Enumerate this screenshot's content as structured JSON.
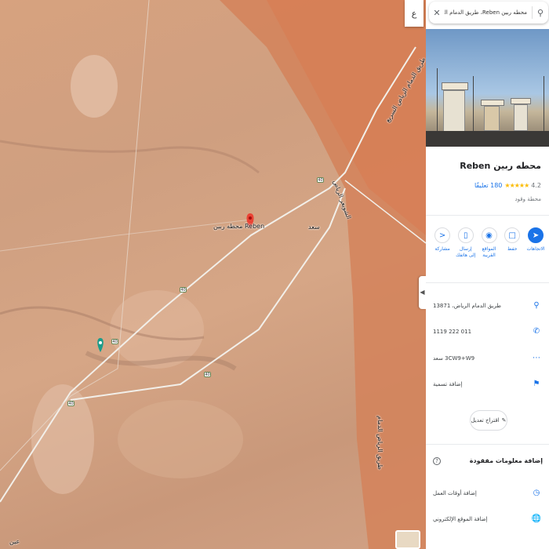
{
  "search": {
    "query": "محطه ربين Reben، طريق الدمام الرياض",
    "search_icon": "search-icon",
    "close_icon": "close-icon"
  },
  "map": {
    "language_button": "ع",
    "collapse_icon": "chevron-left-icon",
    "labels": {
      "place": "محطه ربين Reben",
      "road_ne": "طريق الدمام الرياض السريع",
      "road_e": "الشويعر الرياض",
      "road_se": "طريق الرياض الدمام",
      "small_1": "سعد",
      "small_2": "سعد",
      "bottom_left": "عين"
    },
    "shields": [
      "40",
      "40",
      "40",
      "40",
      "40"
    ]
  },
  "place": {
    "title": "محطه ربين Reben",
    "rating": "4.2",
    "stars": "★★★★★",
    "reviews": "180 تعليقًا",
    "category": "محطة وقود"
  },
  "actions": [
    {
      "label": "الاتجاهات",
      "icon": "directions-icon",
      "primary": true
    },
    {
      "label": "حفظ",
      "icon": "bookmark-icon",
      "primary": false
    },
    {
      "label": "المواقع القريبة",
      "icon": "nearby-icon",
      "primary": false
    },
    {
      "label": "إرسال إلى هاتفك",
      "icon": "send-to-phone-icon",
      "primary": false
    },
    {
      "label": "مشاركة",
      "icon": "share-icon",
      "primary": false
    }
  ],
  "info": {
    "address": "طريق الدمام الرياض، 13871",
    "phone": "011 222 1119",
    "plus_code": "3CW9+W9 سعد",
    "label": "إضافة تسمية"
  },
  "suggest_edit": "اقتراح تعديل",
  "missing": {
    "title": "إضافة معلومات مفقودة",
    "hours": "إضافة أوقات العمل",
    "website": "إضافة الموقع الإلكتروني"
  }
}
